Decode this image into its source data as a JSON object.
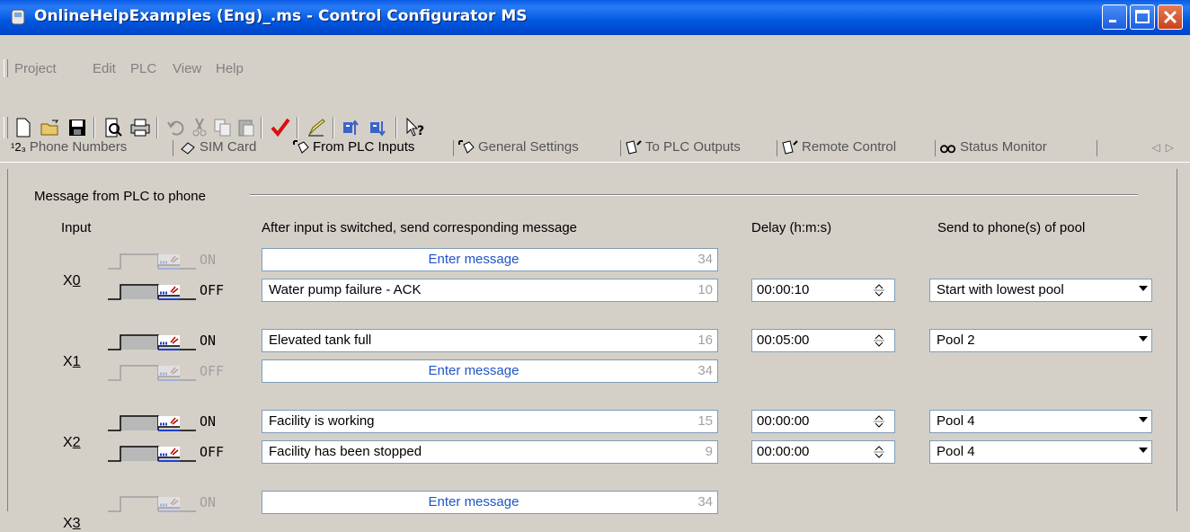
{
  "window": {
    "title": "OnlineHelpExamples (Eng)_.ms - Control Configurator MS",
    "icon": "phone-app-icon"
  },
  "menu": [
    "Project",
    "Edit",
    "PLC",
    "View",
    "Help"
  ],
  "toolbar": [
    "new-icon",
    "open-icon",
    "save-icon",
    "print-preview-icon",
    "print-icon",
    "undo-icon",
    "cut-icon",
    "copy-icon",
    "paste-icon",
    "check-icon",
    "pen-icon",
    "upload-icon",
    "download-icon",
    "help-icon"
  ],
  "tabs": [
    {
      "label": "Phone Numbers",
      "prefix": "¹2₃",
      "active": false
    },
    {
      "label": "SIM Card",
      "active": false
    },
    {
      "label": "From PLC Inputs",
      "active": true
    },
    {
      "label": "General Settings",
      "active": false
    },
    {
      "label": "To PLC Outputs",
      "active": false
    },
    {
      "label": "Remote Control",
      "active": false
    },
    {
      "label": "Status Monitor",
      "active": false
    }
  ],
  "group": {
    "label": "Message from PLC to phone"
  },
  "headers": {
    "input": "Input",
    "message": "After input is switched, send corresponding message",
    "delay": "Delay (h:m:s)",
    "pool": "Send to phone(s) of pool"
  },
  "rows": [
    {
      "input": "X0",
      "underline": "0",
      "on": {
        "label": "ON",
        "enabled": false,
        "message": "Enter message",
        "placeholder": true,
        "count": "34"
      },
      "off": {
        "label": "OFF",
        "enabled": true,
        "message": "Water pump failure - ACK",
        "placeholder": false,
        "count": "10",
        "delay": "00:00:10",
        "pool": "Start with lowest pool"
      }
    },
    {
      "input": "X1",
      "underline": "1",
      "on": {
        "label": "ON",
        "enabled": true,
        "message": "Elevated tank full",
        "placeholder": false,
        "count": "16",
        "delay": "00:05:00",
        "pool": "Pool 2"
      },
      "off": {
        "label": "OFF",
        "enabled": false,
        "message": "Enter message",
        "placeholder": true,
        "count": "34"
      }
    },
    {
      "input": "X2",
      "underline": "2",
      "on": {
        "label": "ON",
        "enabled": true,
        "message": "Facility is working",
        "placeholder": false,
        "count": "15",
        "delay": "00:00:00",
        "pool": "Pool 4"
      },
      "off": {
        "label": "OFF",
        "enabled": true,
        "message": "Facility has been stopped",
        "placeholder": false,
        "count": "9",
        "delay": "00:00:00",
        "pool": "Pool 4"
      }
    },
    {
      "input": "X3",
      "underline": "3",
      "on": {
        "label": "ON",
        "enabled": false,
        "message": "Enter message",
        "placeholder": true,
        "count": "34"
      }
    }
  ]
}
